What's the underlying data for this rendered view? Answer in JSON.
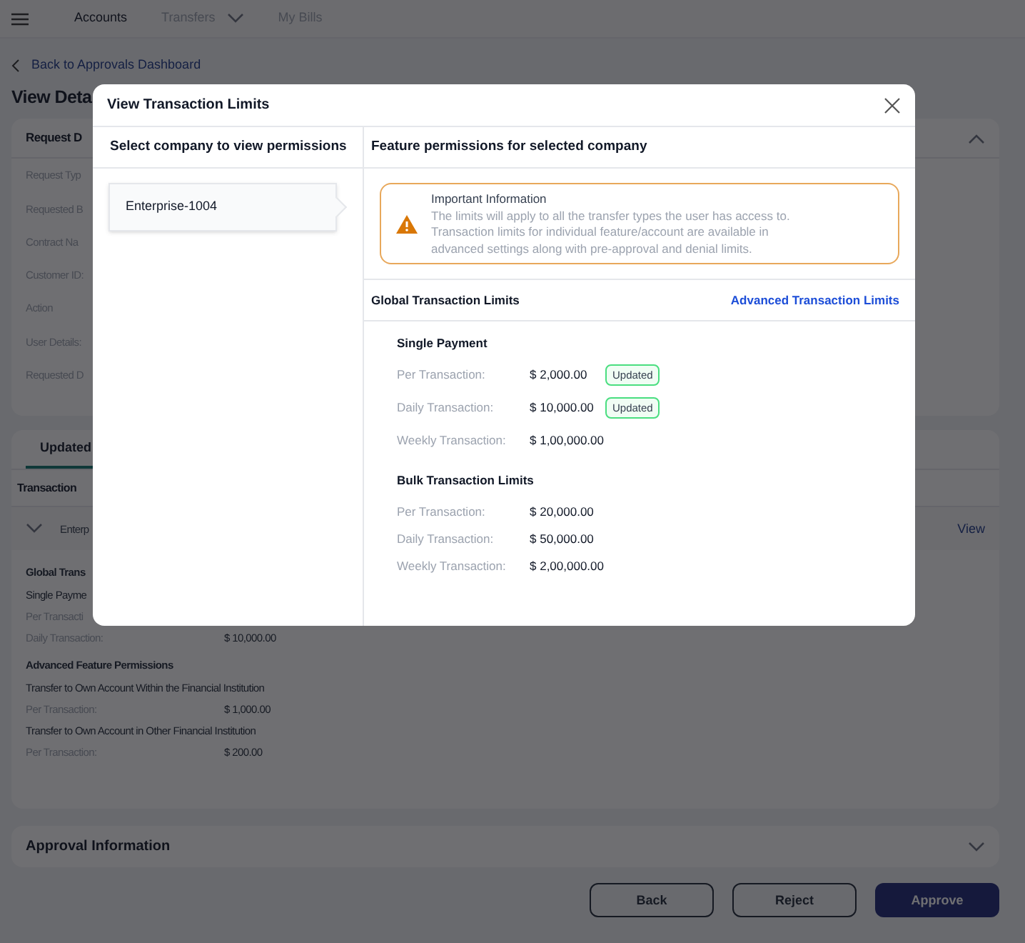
{
  "nav": {
    "items": [
      {
        "label": "Accounts",
        "selected": true,
        "dropdown": false
      },
      {
        "label": "Transfers",
        "selected": false,
        "dropdown": true
      },
      {
        "label": "My Bills",
        "selected": false,
        "dropdown": false
      }
    ]
  },
  "back_link": "Back to Approvals Dashboard",
  "page_title": "View Deta",
  "request_card": {
    "title": "Request D",
    "expanded": true,
    "fields": [
      "Request Typ",
      "Requested B",
      "Contract Na",
      "Customer ID:",
      "Action",
      "User Details:",
      "Requested D"
    ]
  },
  "tabs": [
    {
      "label": "Updated",
      "selected": true
    }
  ],
  "transaction_section": {
    "title": "Transaction",
    "company": {
      "name": "Enterp",
      "expanded": true,
      "link": "View"
    },
    "lines": [
      {
        "kind": "heading",
        "text": "Global Trans"
      },
      {
        "kind": "subheading",
        "text": "Single Payme"
      },
      {
        "kind": "row",
        "text": "Per Transacti"
      },
      {
        "kind": "row",
        "text": "Daily Transaction:",
        "value": "$ 10,000.00"
      },
      {
        "kind": "heading",
        "text": "Advanced Feature Permissions"
      },
      {
        "kind": "subheading",
        "text": "Transfer to Own Account Within the Financial Institution"
      },
      {
        "kind": "row",
        "text": "Per Transaction:",
        "value": "$ 1,000.00"
      },
      {
        "kind": "subheading",
        "text": "Transfer to Own Account in Other Financial Institution"
      },
      {
        "kind": "row",
        "text": "Per Transaction:",
        "value": "$ 200.00"
      }
    ]
  },
  "approval_card": {
    "title": "Approval Information",
    "expanded": false
  },
  "buttons": [
    {
      "label": "Back",
      "kind": "secondary"
    },
    {
      "label": "Reject",
      "kind": "secondary"
    },
    {
      "label": "Approve",
      "kind": "primary"
    }
  ],
  "modal": {
    "title": "View Transaction Limits",
    "left_header": "Select company to view permissions",
    "companies": [
      {
        "name": "Enterprise-1004",
        "selected": true
      }
    ],
    "right_header": "Feature permissions for selected company",
    "alert": {
      "title": "Important Information",
      "text": "The limits will apply to all the transfer types the user has access to. Transaction limits for individual feature/account are available in advanced settings along with pre-approval and denial limits."
    },
    "global": {
      "title": "Global Transaction Limits",
      "link": "Advanced Transaction Limits"
    },
    "groups": [
      {
        "title": "Single Payment",
        "rows": [
          {
            "label": "Per Transaction:",
            "value": "$ 2,000.00",
            "badge": "Updated"
          },
          {
            "label": "Daily Transaction:",
            "value": "$ 10,000.00",
            "badge": "Updated"
          },
          {
            "label": "Weekly Transaction:",
            "value": "$ 1,00,000.00"
          }
        ]
      },
      {
        "title": "Bulk Transaction Limits",
        "rows": [
          {
            "label": "Per Transaction:",
            "value": "$ 20,000.00"
          },
          {
            "label": "Daily Transaction:",
            "value": "$ 50,000.00"
          },
          {
            "label": "Weekly Transaction:",
            "value": "$ 2,00,000.00"
          }
        ]
      }
    ]
  }
}
